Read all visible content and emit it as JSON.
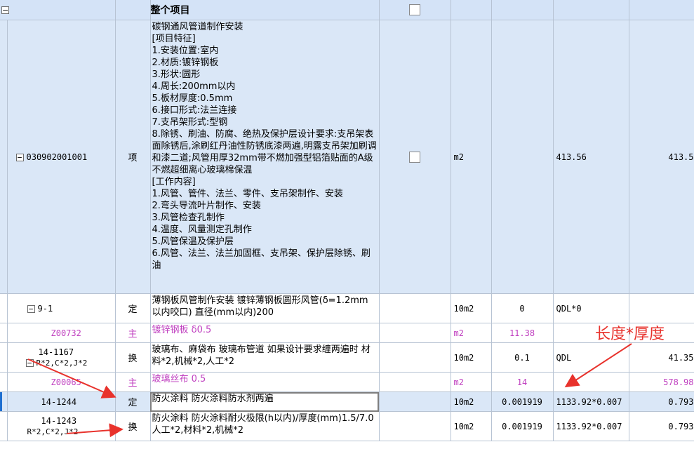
{
  "header": {
    "collapse_glyph": "−",
    "title": "整个项目"
  },
  "item": {
    "code": "030902001001",
    "type": "项",
    "description_lines": [
      "碳钢通风管道制作安装",
      "[项目特征]",
      "1.安装位置:室内",
      "2.材质:镀锌钢板",
      "3.形状:圆形",
      "4.周长:200mm以内",
      "5.板材厚度:0.5mm",
      "6.接口形式:法兰连接",
      "7.支吊架形式:型钢",
      "8.除锈、刷油、防腐、绝热及保护层设计要求:支吊架表面除锈后,涂刷红丹油性防锈底漆两遍,明露支吊架加刷调和漆二道;风管用厚32mm带不燃加强型铝箔贴面的A级不燃超细离心玻璃棉保温",
      "[工作内容]",
      "1.风管、管件、法兰、零件、支吊架制作、安装",
      "2.弯头导流叶片制作、安装",
      "3.风管检查孔制作",
      "4.温度、风量测定孔制作",
      "5.风管保温及保护层",
      "6.风管、法兰、法兰加固框、支吊架、保护层除锈、刷油"
    ],
    "unit": "m2",
    "quantity_expr": "413.56",
    "quantity": "413.5"
  },
  "rows": [
    {
      "code": "9-1",
      "code2": "",
      "type": "定",
      "desc": "薄钢板风管制作安装 镀锌薄钢板圆形风管(δ=1.2mm以内咬口) 直径(mm以内)200",
      "unit": "10m2",
      "qty": "0",
      "expr": "QDL*0",
      "value": "",
      "style": "white",
      "expand": true
    },
    {
      "code": "Z00732",
      "code2": "",
      "type": "主",
      "desc": "镀锌钢板 δ0.5",
      "unit": "m2",
      "qty": "11.38",
      "expr": "",
      "value": "",
      "style": "white magenta",
      "expand": false
    },
    {
      "code": "14-1167",
      "code2": "R*2,C*2,J*2",
      "type": "换",
      "desc": "玻璃布、麻袋布 玻璃布管道 如果设计要求缠两遍时 材料*2,机械*2,人工*2",
      "unit": "10m2",
      "qty": "0.1",
      "expr": "QDL",
      "value": "41.35",
      "style": "white",
      "expand": true
    },
    {
      "code": "Z00065",
      "code2": "",
      "type": "主",
      "desc": "玻璃丝布 0.5",
      "unit": "m2",
      "qty": "14",
      "expr": "",
      "value": "578.98",
      "style": "white magenta",
      "expand": false
    },
    {
      "code": "14-1244",
      "code2": "",
      "type": "定",
      "desc": "防火涂料 防火涂料防水剂两遍",
      "unit": "10m2",
      "qty": "0.001919",
      "expr": "1133.92*0.007",
      "value": "0.793",
      "style": "sel",
      "expand": false
    },
    {
      "code": "14-1243",
      "code2": "R*2,C*2,J*2",
      "type": "换",
      "desc": "防火涂料 防火涂料耐火极限(h以内)/厚度(mm)1.5/7.0 人工*2,材料*2,机械*2",
      "unit": "10m2",
      "qty": "0.001919",
      "expr": "1133.92*0.007",
      "value": "0.793",
      "style": "white",
      "expand": false
    }
  ],
  "annotation": "长度*厚度",
  "colors": {
    "arrow": "#e8322c",
    "tree": "#e0a020",
    "selected_edge": "#1f6fd0",
    "main_material": "#c040c0"
  }
}
